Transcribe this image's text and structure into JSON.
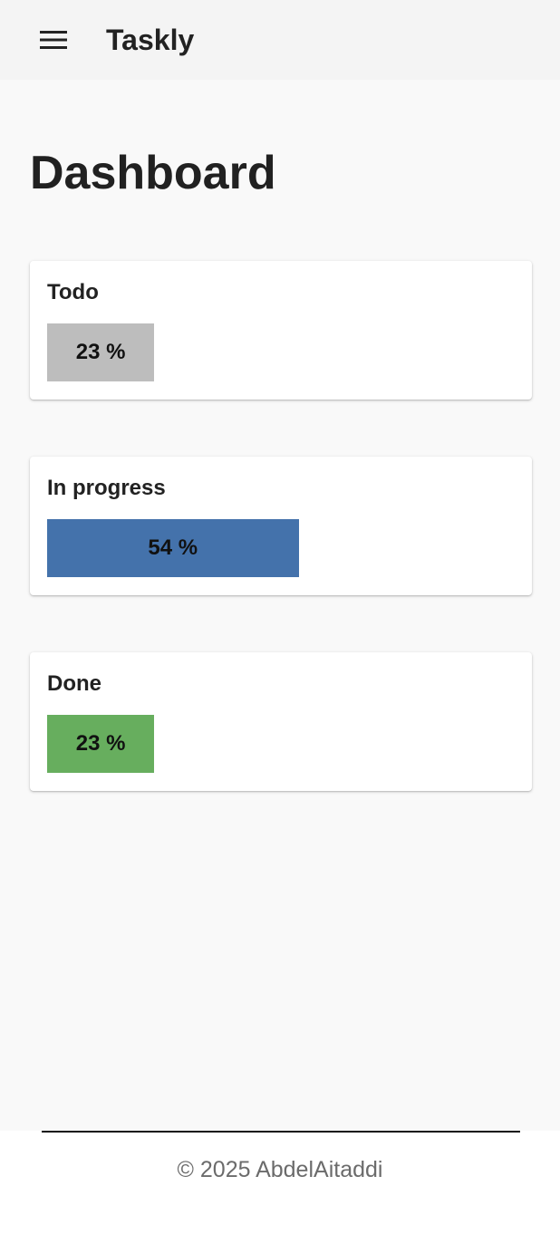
{
  "appbar": {
    "title": "Taskly",
    "menu_icon": "menu-icon"
  },
  "page": {
    "title": "Dashboard"
  },
  "stats": [
    {
      "label": "Todo",
      "percent_text": "23 %",
      "fraction": 0.23,
      "color": "#bdbdbd"
    },
    {
      "label": "In progress",
      "percent_text": "54 %",
      "fraction": 0.54,
      "color": "#4472ab"
    },
    {
      "label": "Done",
      "percent_text": "23 %",
      "fraction": 0.23,
      "color": "#67ae5e"
    }
  ],
  "footer": {
    "text": "© 2025 AbdelAitaddi"
  }
}
